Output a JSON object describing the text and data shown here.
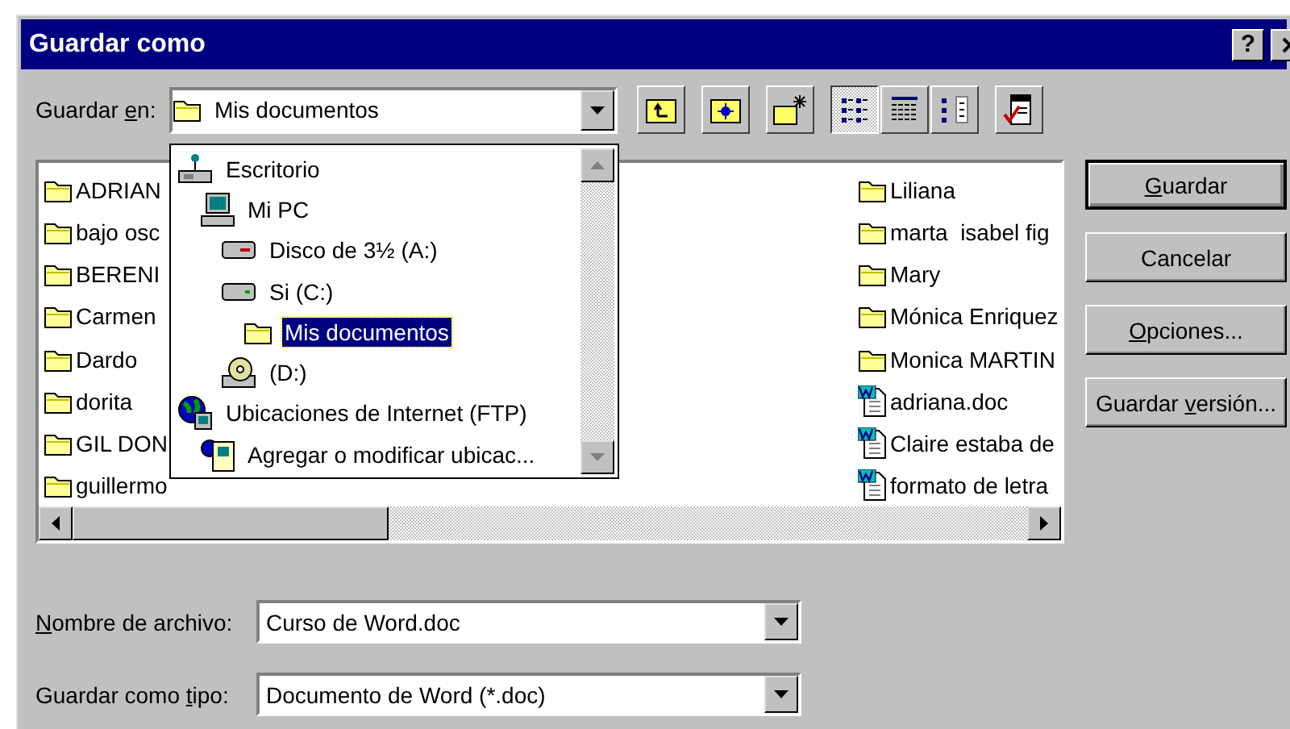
{
  "window": {
    "title": "Guardar como",
    "help_button": "?"
  },
  "location": {
    "label": [
      {
        "text": "Guardar ",
        "underline": false
      },
      {
        "text": "e",
        "underline": true
      },
      {
        "text": "n:",
        "underline": false
      }
    ],
    "value": "Mis documentos"
  },
  "toolbar": [
    {
      "kind": "up-folder",
      "selected": false
    },
    {
      "kind": "search-web",
      "selected": false
    },
    {
      "kind": "new-folder",
      "selected": false
    },
    {
      "kind": "list-view",
      "selected": true
    },
    {
      "kind": "details-view",
      "selected": false
    },
    {
      "kind": "properties-view",
      "selected": false
    },
    {
      "kind": "tools",
      "selected": false
    }
  ],
  "location_dropdown": {
    "items": [
      {
        "label": "Escritorio",
        "kind": "desktop",
        "selected": false,
        "children": [
          {
            "label": "Mi PC",
            "kind": "computer",
            "selected": false,
            "children": [
              {
                "label": "Disco de 3½ (A:)",
                "kind": "floppy",
                "selected": false
              },
              {
                "label": "Si (C:)",
                "kind": "harddrive",
                "selected": false,
                "children": [
                  {
                    "label": "Mis documentos",
                    "kind": "folder",
                    "selected": true
                  }
                ]
              },
              {
                "label": "(D:)",
                "kind": "cdrom",
                "selected": false
              }
            ]
          }
        ]
      },
      {
        "label": "Ubicaciones de Internet (FTP)",
        "kind": "globe",
        "selected": false,
        "children": [
          {
            "label": "Agregar o modificar ubicac...",
            "kind": "globe-computer",
            "selected": false
          }
        ]
      }
    ]
  },
  "file_list": {
    "columns": [
      {
        "items": [
          {
            "name": "ADRIAN",
            "kind": "folder"
          },
          {
            "name": "bajo osc",
            "kind": "folder"
          },
          {
            "name": "BERENI",
            "kind": "folder"
          },
          {
            "name": "Carmen",
            "kind": "folder"
          },
          {
            "name": "Dardo",
            "kind": "folder"
          },
          {
            "name": "dorita",
            "kind": "folder"
          },
          {
            "name": "GIL DON",
            "kind": "folder"
          },
          {
            "name": "guillermo",
            "kind": "folder"
          }
        ]
      },
      {
        "items": [
          {
            "name": "Liliana",
            "kind": "folder"
          },
          {
            "name": "marta  isabel fig",
            "kind": "folder"
          },
          {
            "name": "Mary",
            "kind": "folder"
          },
          {
            "name": "Mónica Enriquez",
            "kind": "folder"
          },
          {
            "name": "Monica MARTIN",
            "kind": "folder"
          },
          {
            "name": "adriana.doc",
            "kind": "document"
          },
          {
            "name": "Claire estaba de",
            "kind": "document"
          },
          {
            "name": "formato de letra",
            "kind": "document"
          }
        ]
      }
    ]
  },
  "buttons": [
    {
      "label": [
        {
          "text": "G",
          "underline": true
        },
        {
          "text": "uardar",
          "underline": false
        }
      ],
      "default": true
    },
    {
      "label": [
        {
          "text": "Cancelar",
          "underline": false
        }
      ],
      "default": false
    },
    {
      "label": [
        {
          "text": "O",
          "underline": true
        },
        {
          "text": "pciones...",
          "underline": false
        }
      ],
      "default": false
    },
    {
      "label": [
        {
          "text": "Guardar ",
          "underline": false
        },
        {
          "text": "v",
          "underline": true
        },
        {
          "text": "ersión...",
          "underline": false
        }
      ],
      "default": false
    }
  ],
  "fields": [
    {
      "label": [
        {
          "text": "N",
          "underline": true
        },
        {
          "text": "ombre de archivo:",
          "underline": false
        }
      ],
      "value": "Curso de Word.doc"
    },
    {
      "label": [
        {
          "text": "Guardar como ",
          "underline": false
        },
        {
          "text": "t",
          "underline": true
        },
        {
          "text": "ipo:",
          "underline": false
        }
      ],
      "value": "Documento de Word (*.doc)"
    }
  ]
}
